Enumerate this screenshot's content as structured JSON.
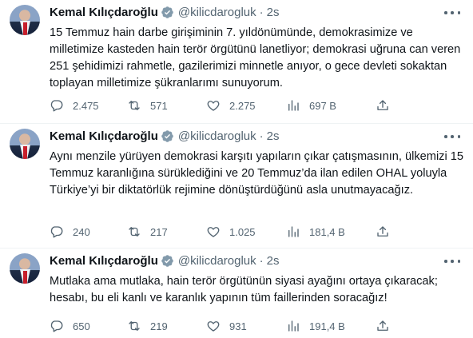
{
  "tweets": [
    {
      "author": "Kemal Kılıçdaroğlu",
      "handle": "@kilicdarogluk",
      "separator": "·",
      "time": "2s",
      "text": "15 Temmuz hain darbe girişiminin 7. yıldönümünde, demokrasimize ve milletimize kasteden hain terör örgütünü lanetliyor; demokrasi uğruna can veren 251 şehidimizi rahmetle, gazilerimizi minnetle anıyor, o gece devleti sokaktan toplayan milletimize şükranlarımı sunuyorum.",
      "replies": "2.475",
      "retweets": "571",
      "likes": "2.275",
      "views": "697 B"
    },
    {
      "author": "Kemal Kılıçdaroğlu",
      "handle": "@kilicdarogluk",
      "separator": "·",
      "time": "2s",
      "text": "Aynı menzile yürüyen demokrasi karşıtı yapıların çıkar çatışmasının, ülkemizi 15 Temmuz karanlığına sürüklediğini ve 20 Temmuz’da ilan edilen OHAL yoluyla Türkiye’yi bir diktatörlük rejimine dönüştürdüğünü asla unutmayacağız.",
      "replies": "240",
      "retweets": "217",
      "likes": "1.025",
      "views": "181,4 B"
    },
    {
      "author": "Kemal Kılıçdaroğlu",
      "handle": "@kilicdarogluk",
      "separator": "·",
      "time": "2s",
      "text": "Mutlaka ama mutlaka, hain terör örgütünün siyasi ayağını ortaya çıkaracak; hesabı, bu eli kanlı ve karanlık yapının tüm faillerinden soracağız!",
      "replies": "650",
      "retweets": "219",
      "likes": "931",
      "views": "191,4 B"
    }
  ],
  "icons": {
    "verified": "verified-badge-icon",
    "more": "more-options-icon",
    "reply": "reply-icon",
    "retweet": "retweet-icon",
    "like": "like-icon",
    "views": "views-icon",
    "share": "share-icon"
  },
  "colors": {
    "verified_badge": "#829aab",
    "text": "#0f1419",
    "secondary_text": "#536471",
    "divider": "#eff3f4"
  }
}
